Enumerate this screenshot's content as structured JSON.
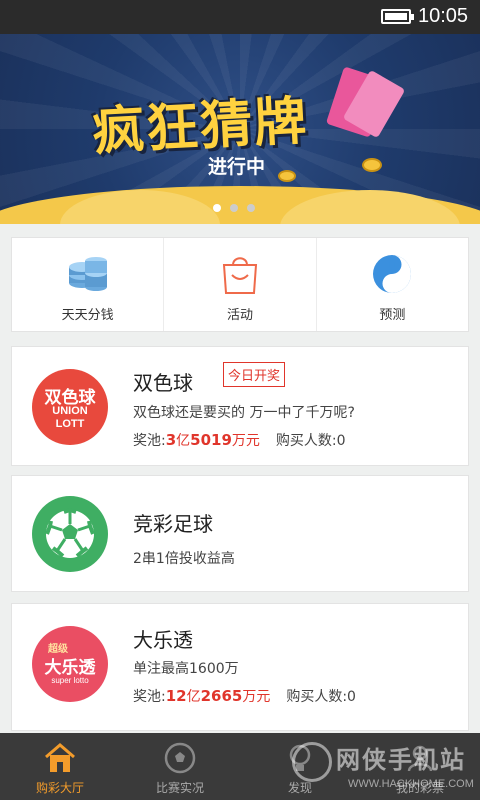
{
  "status_bar": {
    "time": "10:05"
  },
  "banner": {
    "title": "疯狂猜牌",
    "subtitle": "进行中",
    "slide_count": 3,
    "active_slide": 1
  },
  "quick_menu": [
    {
      "label": "天天分钱",
      "icon": "coin-stack-icon"
    },
    {
      "label": "活动",
      "icon": "gift-bag-icon"
    },
    {
      "label": "预测",
      "icon": "yin-yang-icon"
    }
  ],
  "lotteries": [
    {
      "name": "双色球",
      "badge": "今日开奖",
      "desc": "双色球还是要买的 万一中了千万呢?",
      "pool_label": "奖池:",
      "pool_parts": [
        "3",
        "亿",
        "5019",
        "万元"
      ],
      "buyers_label": "购买人数:0",
      "logo_text": "双色球",
      "logo_sub1": "UNION",
      "logo_sub2": "LOTT",
      "logo_color": "#e8493d"
    },
    {
      "name": "竞彩足球",
      "desc": "2串1倍投收益高",
      "logo_color": "#3fae63"
    },
    {
      "name": "大乐透",
      "desc": "单注最高1600万",
      "pool_label": "奖池:",
      "pool_parts": [
        "12",
        "亿",
        "2665",
        "万元"
      ],
      "buyers_label": "购买人数:0",
      "logo_text": "大乐透",
      "logo_top": "超级",
      "logo_bottom": "super lotto",
      "logo_color": "#ea4e63"
    }
  ],
  "bottom_nav": [
    {
      "label": "购彩大厅",
      "icon": "home-icon",
      "active": true
    },
    {
      "label": "比赛实况",
      "icon": "soccer-ball-icon",
      "active": false
    },
    {
      "label": "发现",
      "icon": "bulb-icon",
      "active": false
    },
    {
      "label": "我的彩票",
      "icon": "user-icon",
      "active": false
    }
  ],
  "watermark": {
    "text": "网侠手机站",
    "url": "WWW.HACKHOME.COM"
  }
}
